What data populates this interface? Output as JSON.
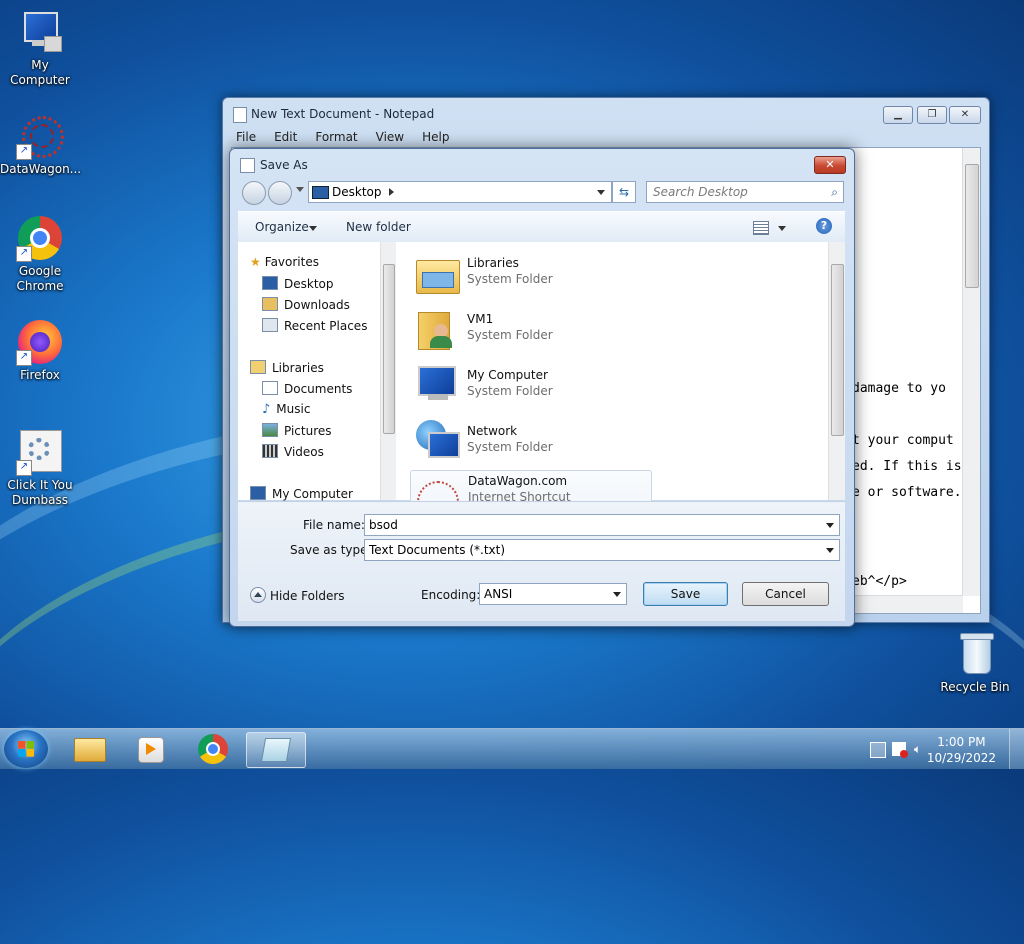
{
  "desktop": {
    "icons": [
      {
        "label": "My Computer",
        "icon": "computer-icon"
      },
      {
        "label": "DataWagon...",
        "icon": "datawagon-icon"
      },
      {
        "label": "Google Chrome",
        "icon": "chrome-icon"
      },
      {
        "label": "Firefox",
        "icon": "firefox-icon"
      },
      {
        "label": "Click It You Dumbass",
        "icon": "settings-gear-icon"
      },
      {
        "label": "Recycle Bin",
        "icon": "recycle-bin-icon"
      }
    ]
  },
  "notepad": {
    "title": "New Text Document - Notepad",
    "menu": [
      "File",
      "Edit",
      "Format",
      "View",
      "Help"
    ],
    "visible_lines": [
      "damage to yo",
      "t your comput",
      "ed. If this is",
      "e or software.",
      "eb^</p>"
    ]
  },
  "save_as": {
    "title": "Save As",
    "address": "Desktop",
    "search_placeholder": "Search Desktop",
    "toolbar": {
      "organize": "Organize",
      "new_folder": "New folder"
    },
    "nav": {
      "favorites": "Favorites",
      "favorites_items": [
        "Desktop",
        "Downloads",
        "Recent Places"
      ],
      "libraries": "Libraries",
      "libraries_items": [
        "Documents",
        "Music",
        "Pictures",
        "Videos"
      ],
      "computer": "My Computer"
    },
    "files": [
      {
        "name": "Libraries",
        "type": "System Folder",
        "icon": "libraries-folder-icon"
      },
      {
        "name": "VM1",
        "type": "System Folder",
        "icon": "user-folder-icon"
      },
      {
        "name": "My Computer",
        "type": "System Folder",
        "icon": "computer-icon"
      },
      {
        "name": "Network",
        "type": "System Folder",
        "icon": "network-icon"
      },
      {
        "name": "DataWagon.com",
        "type": "Internet Shortcut",
        "icon": "datawagon-icon"
      }
    ],
    "file_name_label": "File name:",
    "file_name_value": "bsod",
    "save_type_label": "Save as type:",
    "save_type_value": "Text Documents (*.txt)",
    "hide_folders": "Hide Folders",
    "encoding_label": "Encoding:",
    "encoding_value": "ANSI",
    "save_button": "Save",
    "cancel_button": "Cancel"
  },
  "taskbar": {
    "time": "1:00 PM",
    "date": "10/29/2022"
  }
}
